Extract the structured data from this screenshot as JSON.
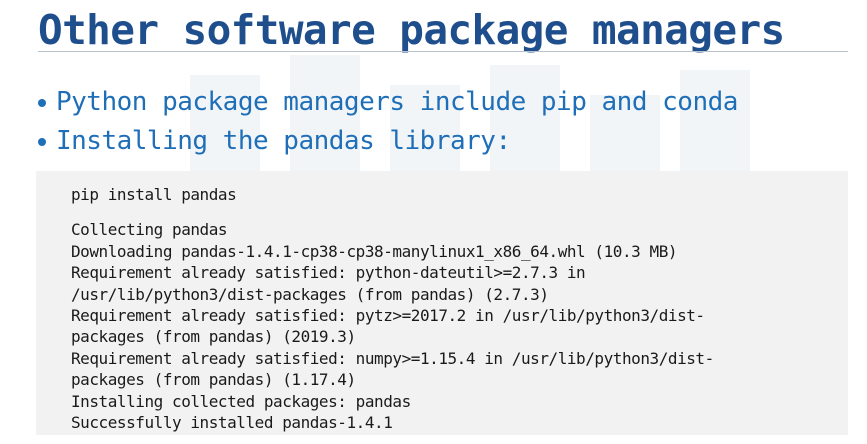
{
  "slide": {
    "title": "Other software package managers",
    "bullets": [
      {
        "text": "Python package managers include pip and conda"
      },
      {
        "text": "Installing the pandas library:"
      }
    ],
    "code": {
      "command": "pip install pandas",
      "output": [
        "Collecting pandas",
        "Downloading pandas-1.4.1-cp38-cp38-manylinux1_x86_64.whl (10.3 MB)",
        "Requirement already satisfied: python-dateutil>=2.7.3 in",
        "/usr/lib/python3/dist-packages (from pandas) (2.7.3)",
        "Requirement already satisfied: pytz>=2017.2 in /usr/lib/python3/dist-",
        "packages (from pandas) (2019.3)",
        "Requirement already satisfied: numpy>=1.15.4 in /usr/lib/python3/dist-",
        "packages (from pandas) (1.17.4)",
        "Installing collected packages: pandas",
        "Successfully installed pandas-1.4.1"
      ]
    }
  },
  "colors": {
    "title": "#1f4e8c",
    "bullet_text": "#1f6fb8",
    "code_background": "#f2f2f2",
    "code_text": "#1a1a1a"
  }
}
